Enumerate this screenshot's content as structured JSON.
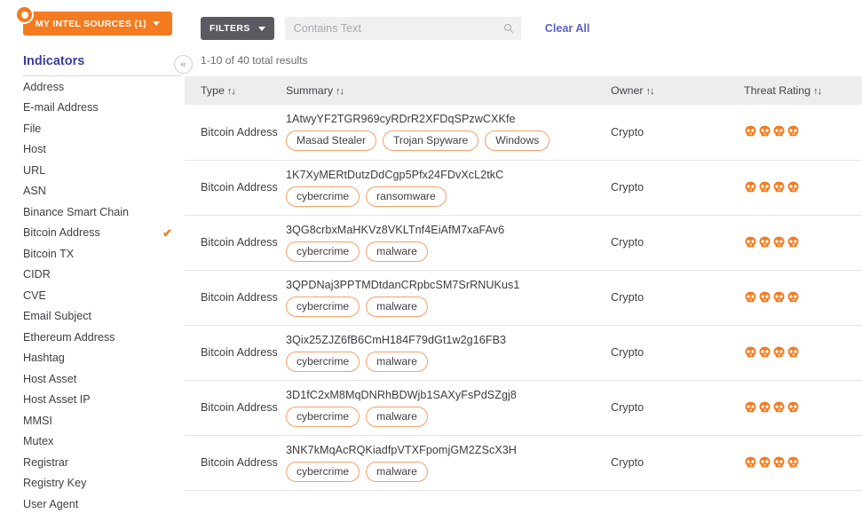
{
  "sidebar": {
    "intel_sources_button": "MY INTEL SOURCES (1)",
    "intel_badge_icon": "dot-badge-icon",
    "title": "Indicators",
    "collapse_icon": "«",
    "selected_check": "✔",
    "items": [
      {
        "label": "Address",
        "selected": false
      },
      {
        "label": "E-mail Address",
        "selected": false
      },
      {
        "label": "File",
        "selected": false
      },
      {
        "label": "Host",
        "selected": false
      },
      {
        "label": "URL",
        "selected": false
      },
      {
        "label": "ASN",
        "selected": false
      },
      {
        "label": "Binance Smart Chain",
        "selected": false
      },
      {
        "label": "Bitcoin Address",
        "selected": true
      },
      {
        "label": "Bitcoin TX",
        "selected": false
      },
      {
        "label": "CIDR",
        "selected": false
      },
      {
        "label": "CVE",
        "selected": false
      },
      {
        "label": "Email Subject",
        "selected": false
      },
      {
        "label": "Ethereum Address",
        "selected": false
      },
      {
        "label": "Hashtag",
        "selected": false
      },
      {
        "label": "Host Asset",
        "selected": false
      },
      {
        "label": "Host Asset IP",
        "selected": false
      },
      {
        "label": "MMSI",
        "selected": false
      },
      {
        "label": "Mutex",
        "selected": false
      },
      {
        "label": "Registrar",
        "selected": false
      },
      {
        "label": "Registry Key",
        "selected": false
      },
      {
        "label": "User Agent",
        "selected": false
      }
    ]
  },
  "toolbar": {
    "filters_label": "FILTERS",
    "search_placeholder": "Contains Text",
    "search_value": "",
    "clear_all_label": "Clear All"
  },
  "results": {
    "count_text": "1-10 of 40 total results"
  },
  "table": {
    "headers": {
      "type": "Type",
      "summary": "Summary",
      "owner": "Owner",
      "threat_rating": "Threat Rating"
    },
    "sort_icon": "↑↓",
    "rows": [
      {
        "type": "Bitcoin Address",
        "summary": "1AtwyYF2TGR969cyRDrR2XFDqSPzwCXKfe",
        "tags": [
          "Masad Stealer",
          "Trojan Spyware",
          "Windows"
        ],
        "owner": "Crypto",
        "threat_rating": 4
      },
      {
        "type": "Bitcoin Address",
        "summary": "1K7XyMERtDutzDdCgp5Pfx24FDvXcL2tkC",
        "tags": [
          "cybercrime",
          "ransomware"
        ],
        "owner": "Crypto",
        "threat_rating": 4
      },
      {
        "type": "Bitcoin Address",
        "summary": "3QG8crbxMaHKVz8VKLTnf4EiAfM7xaFAv6",
        "tags": [
          "cybercrime",
          "malware"
        ],
        "owner": "Crypto",
        "threat_rating": 4
      },
      {
        "type": "Bitcoin Address",
        "summary": "3QPDNaj3PPTMDtdanCRpbcSM7SrRNUKus1",
        "tags": [
          "cybercrime",
          "malware"
        ],
        "owner": "Crypto",
        "threat_rating": 4
      },
      {
        "type": "Bitcoin Address",
        "summary": "3Qix25ZJZ6fB6CmH184F79dGt1w2g16FB3",
        "tags": [
          "cybercrime",
          "malware"
        ],
        "owner": "Crypto",
        "threat_rating": 4
      },
      {
        "type": "Bitcoin Address",
        "summary": "3D1fC2xM8MqDNRhBDWjb1SAXyFsPdSZgj8",
        "tags": [
          "cybercrime",
          "malware"
        ],
        "owner": "Crypto",
        "threat_rating": 4
      },
      {
        "type": "Bitcoin Address",
        "summary": "3NK7kMqAcRQKiadfpVTXFpomjGM2ZScX3H",
        "tags": [
          "cybercrime",
          "malware"
        ],
        "owner": "Crypto",
        "threat_rating": 4
      }
    ]
  },
  "colors": {
    "brand_orange": "#f47b20",
    "tag_border": "#f4a06a",
    "skull_orange": "#f47b20",
    "link_blue": "#5b62c4",
    "sidebar_title_blue": "#3b3f9c",
    "filters_gray": "#5a5a62"
  }
}
